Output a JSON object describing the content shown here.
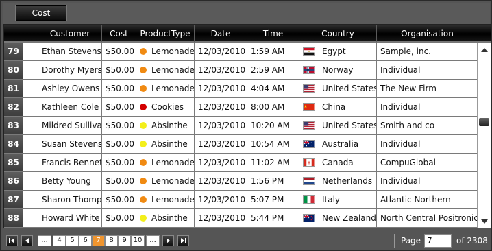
{
  "group_panel": {
    "chip_label": "Cost"
  },
  "columns": [
    "Customer",
    "Cost",
    "ProductType",
    "Date",
    "Time",
    "Country",
    "Organisation"
  ],
  "product_colors": {
    "Lemonade": "#f08a12",
    "Cookies": "#d30000",
    "Absinthe": "#f3ef1b"
  },
  "rows": [
    {
      "num": "79",
      "customer": "Ethan Stevens",
      "cost": "$50.00",
      "product": "Lemonade",
      "date": "12/03/2010",
      "time": "1:59 AM",
      "country": "Egypt",
      "flag": "egypt-flag-icon",
      "org": "Sample, inc."
    },
    {
      "num": "80",
      "customer": "Dorothy Myers",
      "cost": "$50.00",
      "product": "Lemonade",
      "date": "12/03/2010",
      "time": "2:59 AM",
      "country": "Norway",
      "flag": "norway-flag-icon",
      "org": "Individual"
    },
    {
      "num": "81",
      "customer": "Ashley Owens",
      "cost": "$50.00",
      "product": "Lemonade",
      "date": "12/03/2010",
      "time": "4:04 AM",
      "country": "United States",
      "flag": "us-flag-icon",
      "org": "The New Firm"
    },
    {
      "num": "82",
      "customer": "Kathleen Cole",
      "cost": "$50.00",
      "product": "Cookies",
      "date": "12/03/2010",
      "time": "8:00 AM",
      "country": "China",
      "flag": "china-flag-icon",
      "org": "Individual"
    },
    {
      "num": "83",
      "customer": "Mildred Sullivan",
      "cost": "$50.00",
      "product": "Absinthe",
      "date": "12/03/2010",
      "time": "10:20 AM",
      "country": "United States",
      "flag": "us-flag-icon",
      "org": "Smith and co"
    },
    {
      "num": "84",
      "customer": "Susan Stevens",
      "cost": "$50.00",
      "product": "Absinthe",
      "date": "12/03/2010",
      "time": "10:54 AM",
      "country": "Australia",
      "flag": "australia-flag-icon",
      "org": "Individual"
    },
    {
      "num": "85",
      "customer": "Francis Bennett",
      "cost": "$50.00",
      "product": "Lemonade",
      "date": "12/03/2010",
      "time": "11:02 AM",
      "country": "Canada",
      "flag": "canada-flag-icon",
      "org": "CompuGlobal"
    },
    {
      "num": "86",
      "customer": "Betty Young",
      "cost": "$50.00",
      "product": "Lemonade",
      "date": "12/03/2010",
      "time": "1:56 PM",
      "country": "Netherlands",
      "flag": "netherlands-flag-icon",
      "org": "Individual"
    },
    {
      "num": "87",
      "customer": "Sharon Thompson",
      "cost": "$50.00",
      "product": "Lemonade",
      "date": "12/03/2010",
      "time": "5:07 PM",
      "country": "Italy",
      "flag": "italy-flag-icon",
      "org": "Atlantic Northern"
    },
    {
      "num": "88",
      "customer": "Howard White",
      "cost": "$50.00",
      "product": "Absinthe",
      "date": "12/03/2010",
      "time": "5:44 PM",
      "country": "New Zealand",
      "flag": "new-zealand-flag-icon",
      "org": "North Central Positronics"
    }
  ],
  "pager": {
    "pages": [
      "...",
      "4",
      "5",
      "6",
      "7",
      "8",
      "9",
      "10",
      "..."
    ],
    "current": "7",
    "page_label": "Page",
    "of_label": "of 2308",
    "accent": "#f0952f"
  }
}
